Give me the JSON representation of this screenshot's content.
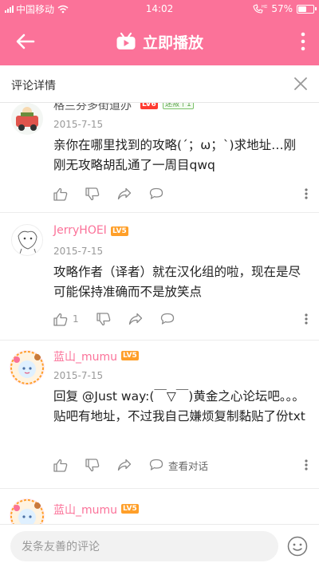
{
  "status_bar": {
    "carrier": "中国移动",
    "time": "14:02",
    "battery": "57%",
    "battery_level": 0.57
  },
  "app_bar": {
    "title": "立即播放",
    "brand_color": "#fb7299"
  },
  "sub_header": {
    "label": "评论详情"
  },
  "comments": [
    {
      "username": "格兰芬多街道办",
      "level": "LV6",
      "badge": "迷叛丨1",
      "date": "2015-7-15",
      "text": "亲你在哪里找到的攻略(´；ω；`)求地址…刚刚无攻略胡乱通了一周目qwq",
      "like_count": "",
      "view_conversation": ""
    },
    {
      "username": "JerryHOEI",
      "level": "LV5",
      "date": "2015-7-15",
      "text": "攻略作者（译者）就在汉化组的啦，现在是尽可能保持准确而不是放笑点",
      "like_count": "1",
      "view_conversation": ""
    },
    {
      "username": "蓝山_mumu",
      "level": "LV5",
      "date": "2015-7-15",
      "text": "回复 @Just way:(￣▽￣)黄金之心论坛吧。。。贴吧有地址，不过我自己嫌烦复制黏贴了份txt",
      "like_count": "",
      "view_conversation": "查看对话"
    },
    {
      "username": "蓝山_mumu",
      "level": "LV5"
    }
  ],
  "bottom_bar": {
    "input_placeholder": "发条友善的评论"
  },
  "icons": [
    "back-arrow-icon",
    "tv-logo-icon",
    "more-vertical-icon",
    "close-icon",
    "thumb-up-icon",
    "thumb-down-icon",
    "share-icon",
    "reply-icon",
    "emoji-icon"
  ]
}
